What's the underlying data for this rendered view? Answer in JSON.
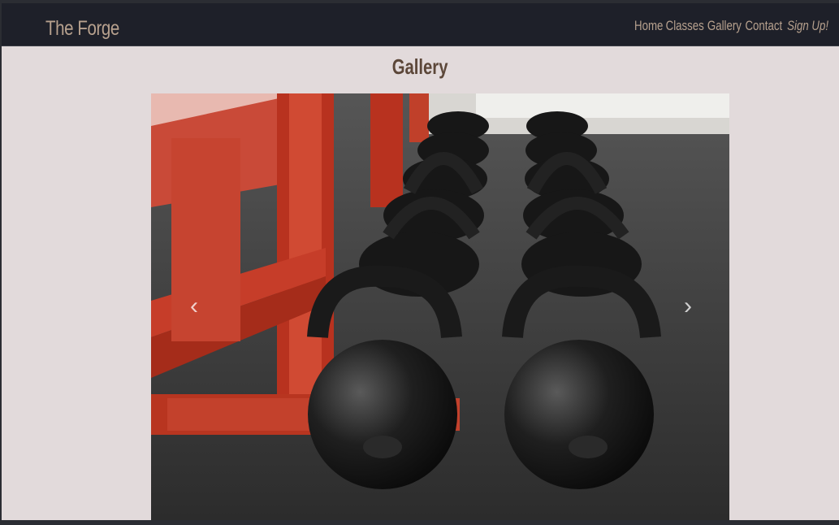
{
  "brand": "The Forge",
  "nav": {
    "home": "Home",
    "classes": "Classes",
    "gallery": "Gallery",
    "contact": "Contact",
    "signup": "Sign Up!"
  },
  "page_title": "Gallery",
  "carousel": {
    "prev_icon": "‹",
    "next_icon": "›",
    "image_subject": "rows of black kettlebells beside red rack"
  },
  "colors": {
    "navbar": "#1e2029",
    "page_bg": "#e2dadb",
    "nav_text": "#b7a18e",
    "title_text": "#5c4739"
  }
}
